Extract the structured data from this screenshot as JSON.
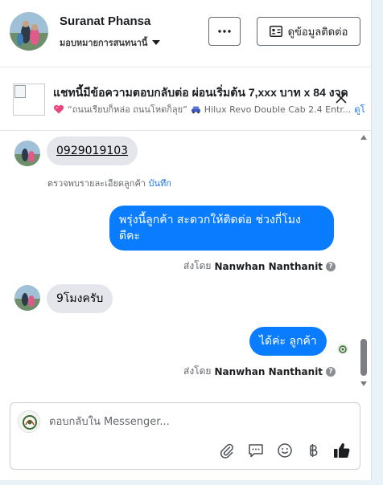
{
  "header": {
    "name": "Suranat Phansa",
    "subtitle": "มอบหมายการสนทนานี้",
    "contact_button": "ดูข้อมูลติดต่อ"
  },
  "context": {
    "title": "แชทนี้มีข้อความตอบกลับต่อ ผ่อนเริ่มต้น 7,xxx บาท x 84 งวด",
    "subtitle": "“ถนนเรียบก็หล่อ ถนนโหดก็ลุย”",
    "vehicle": "Hilux Revo Double Cab 2.4 Entr...",
    "link": "ดูโ"
  },
  "messages": {
    "phone": "0929019103",
    "note_text": "ตรวจพบรายละเอียดลูกค้า",
    "note_link": "บันทึก",
    "out1_line1": "พรุ่งนี้ลูกค้า  สะดวกให้ติดต่อ ช่วงกี่โมง",
    "out1_line2": "ดีคะ",
    "sent_by_label": "ส่งโดย",
    "sender": "Nanwhan Nanthanit",
    "in2": "9โมงครับ",
    "out2": "ได้ค่ะ  ลูกค้า"
  },
  "composer": {
    "placeholder": "ตอบกลับใน Messenger..."
  },
  "colors": {
    "accent": "#0a7cff",
    "link": "#1a73e8",
    "incoming_bubble": "#e4e6eb"
  },
  "icons": [
    "more-icon",
    "contact-card-icon",
    "close-icon",
    "heart-icon",
    "car-icon",
    "paperclip-icon",
    "saved-reply-icon",
    "emoji-icon",
    "baht-icon",
    "thumbs-up-icon",
    "help-icon"
  ]
}
